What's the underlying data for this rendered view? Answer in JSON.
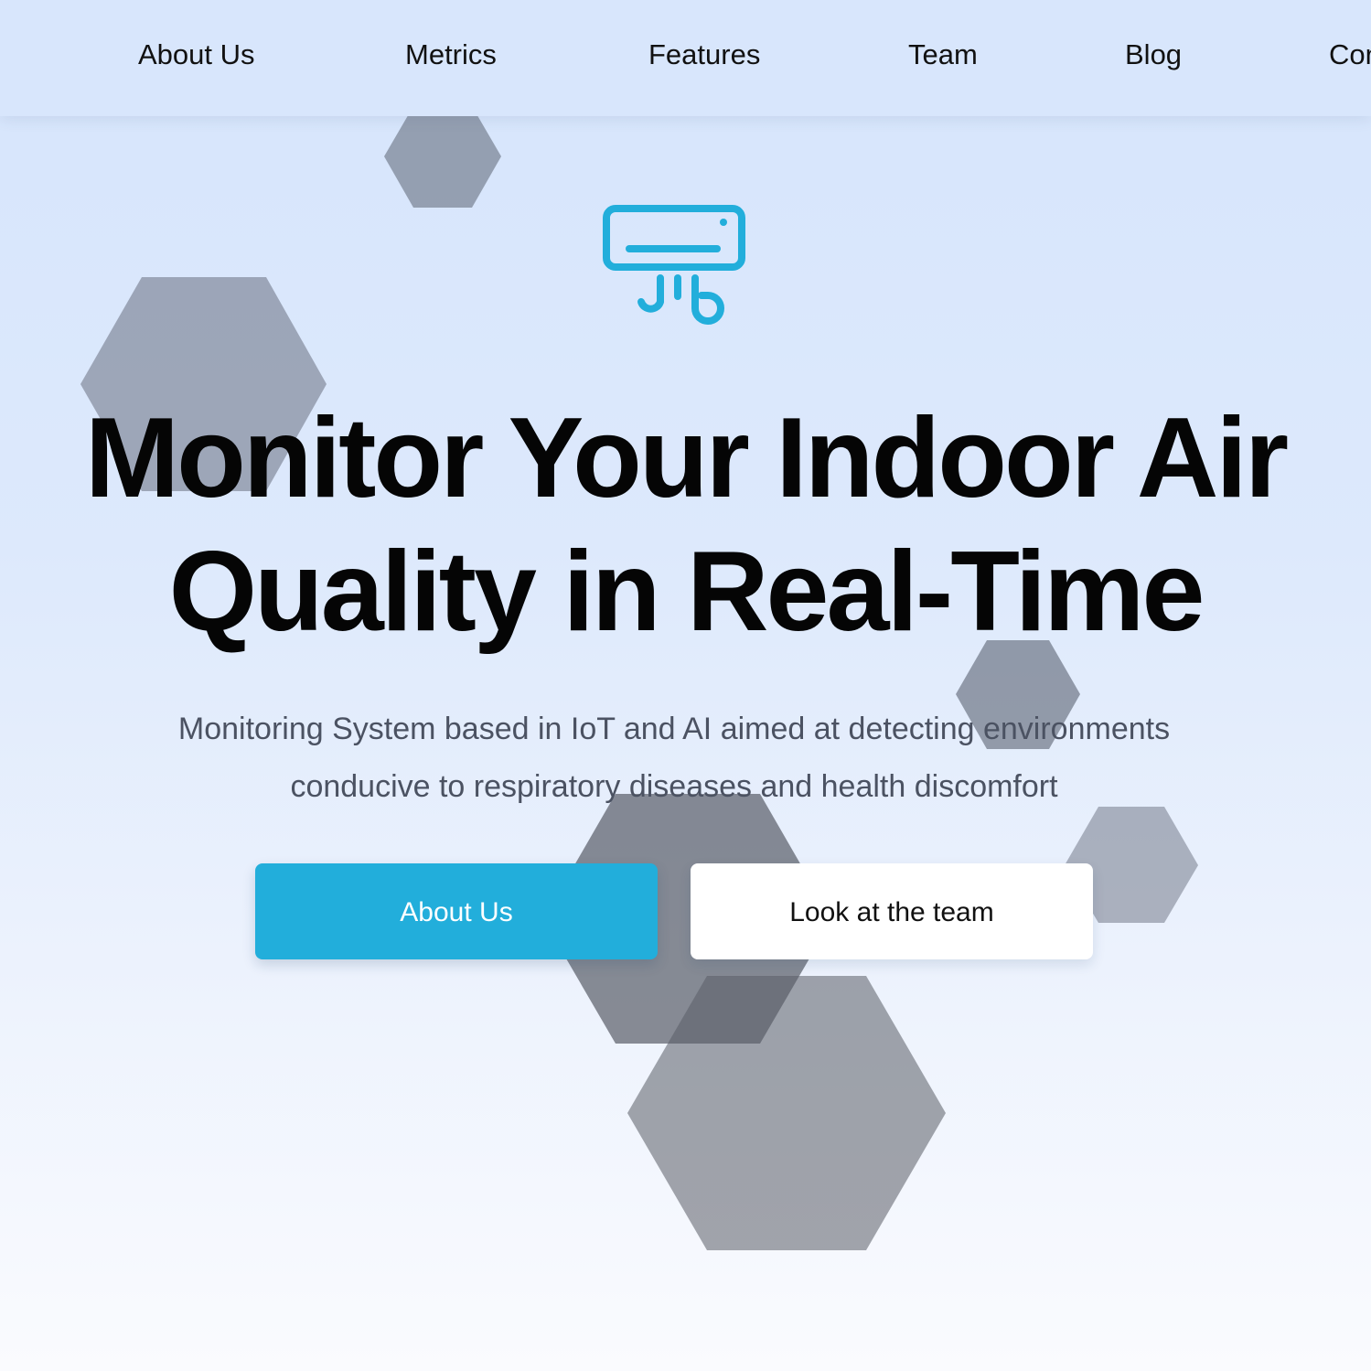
{
  "nav": {
    "items": [
      {
        "label": "About Us"
      },
      {
        "label": "Metrics"
      },
      {
        "label": "Features"
      },
      {
        "label": "Team"
      },
      {
        "label": "Blog"
      },
      {
        "label": "Con"
      }
    ]
  },
  "hero": {
    "icon": "air-conditioner-icon",
    "headline_line1": "Monitor Your Indoor Air",
    "headline_line2": "Quality in Real-Time",
    "subtext_line1": "Monitoring System based in IoT and AI aimed at detecting environments",
    "subtext_line2": "conducive to respiratory diseases and health discomfort",
    "primary_button": "About Us",
    "secondary_button": "Look at the team"
  },
  "colors": {
    "accent": "#22aedb",
    "nav_background": "#d8e6fc",
    "headline": "#050505",
    "subtext": "#4b5262"
  }
}
